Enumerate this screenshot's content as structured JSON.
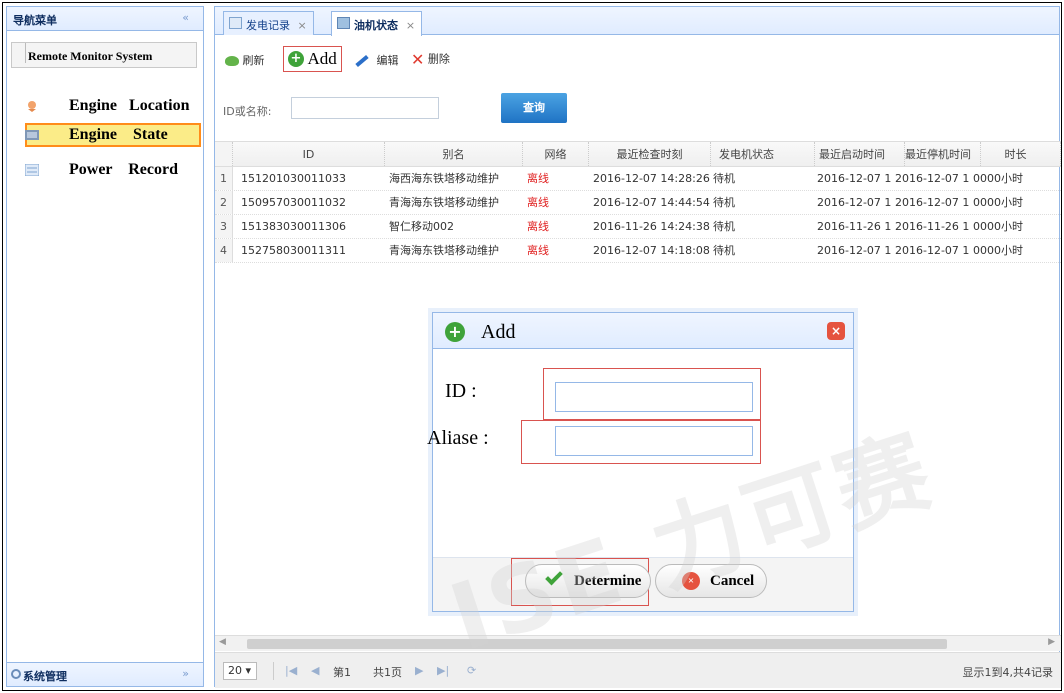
{
  "sidebar": {
    "title": "导航菜单",
    "collapse_icon": "«",
    "system_label": "Remote Monitor System",
    "items": [
      {
        "label": "Engine   Location",
        "icon": "location-pin-icon"
      },
      {
        "label": "Engine    State",
        "icon": "engine-icon",
        "selected": true
      },
      {
        "label": "Power    Record",
        "icon": "record-icon"
      }
    ],
    "footer_label": "系统管理",
    "footer_chevron": "»"
  },
  "tabs": [
    {
      "label": "发电记录",
      "close": "×"
    },
    {
      "label": "油机状态",
      "close": "×",
      "active": true
    }
  ],
  "toolbar": {
    "refresh_label": "刷新",
    "add_label": "Add",
    "edit_label": "编辑",
    "delete_label": "删除"
  },
  "search": {
    "label": "ID或名称:",
    "value": "",
    "button_label": "查询"
  },
  "grid": {
    "columns": [
      "ID",
      "别名",
      "网络",
      "最近检查时刻",
      "发电机状态",
      "最近启动时间",
      "最近停机时间",
      "时长"
    ],
    "rows": [
      {
        "rn": "1",
        "id": "151201030011033",
        "alias": "海西海东铁塔移动维护",
        "network": "离线",
        "checked": "2016-12-07 14:28:26",
        "state": "待机",
        "start": "2016-12-07 1",
        "stop": "2016-12-07 1",
        "duration": "0000小时"
      },
      {
        "rn": "2",
        "id": "150957030011032",
        "alias": "青海海东铁塔移动维护",
        "network": "离线",
        "checked": "2016-12-07 14:44:54",
        "state": "待机",
        "start": "2016-12-07 1",
        "stop": "2016-12-07 1",
        "duration": "0000小时"
      },
      {
        "rn": "3",
        "id": "151383030011306",
        "alias": "智仁移动002",
        "network": "离线",
        "checked": "2016-11-26 14:24:38",
        "state": "待机",
        "start": "2016-11-26 1",
        "stop": "2016-11-26 1",
        "duration": "0000小时"
      },
      {
        "rn": "4",
        "id": "152758030011311",
        "alias": "青海海东铁塔移动维护",
        "network": "离线",
        "checked": "2016-12-07 14:18:08",
        "state": "待机",
        "start": "2016-12-07 1",
        "stop": "2016-12-07 1",
        "duration": "0000小时"
      }
    ]
  },
  "pager": {
    "page_size": "20",
    "page_label": "第1",
    "total_pages": "共1页",
    "info": "显示1到4,共4记录"
  },
  "dialog": {
    "title": "Add",
    "id_label": "ID :",
    "alias_label": "Aliase :",
    "id_value": "",
    "alias_value": "",
    "ok_label": "Determine",
    "cancel_label": "Cancel"
  },
  "watermark": "ISE 力可赛",
  "colors": {
    "accent": "#95b8e7",
    "highlight_border": "#d9534f",
    "selected_bg": "#fbec88",
    "offline_text": "#e02020",
    "query_button": "#1f73c4"
  }
}
